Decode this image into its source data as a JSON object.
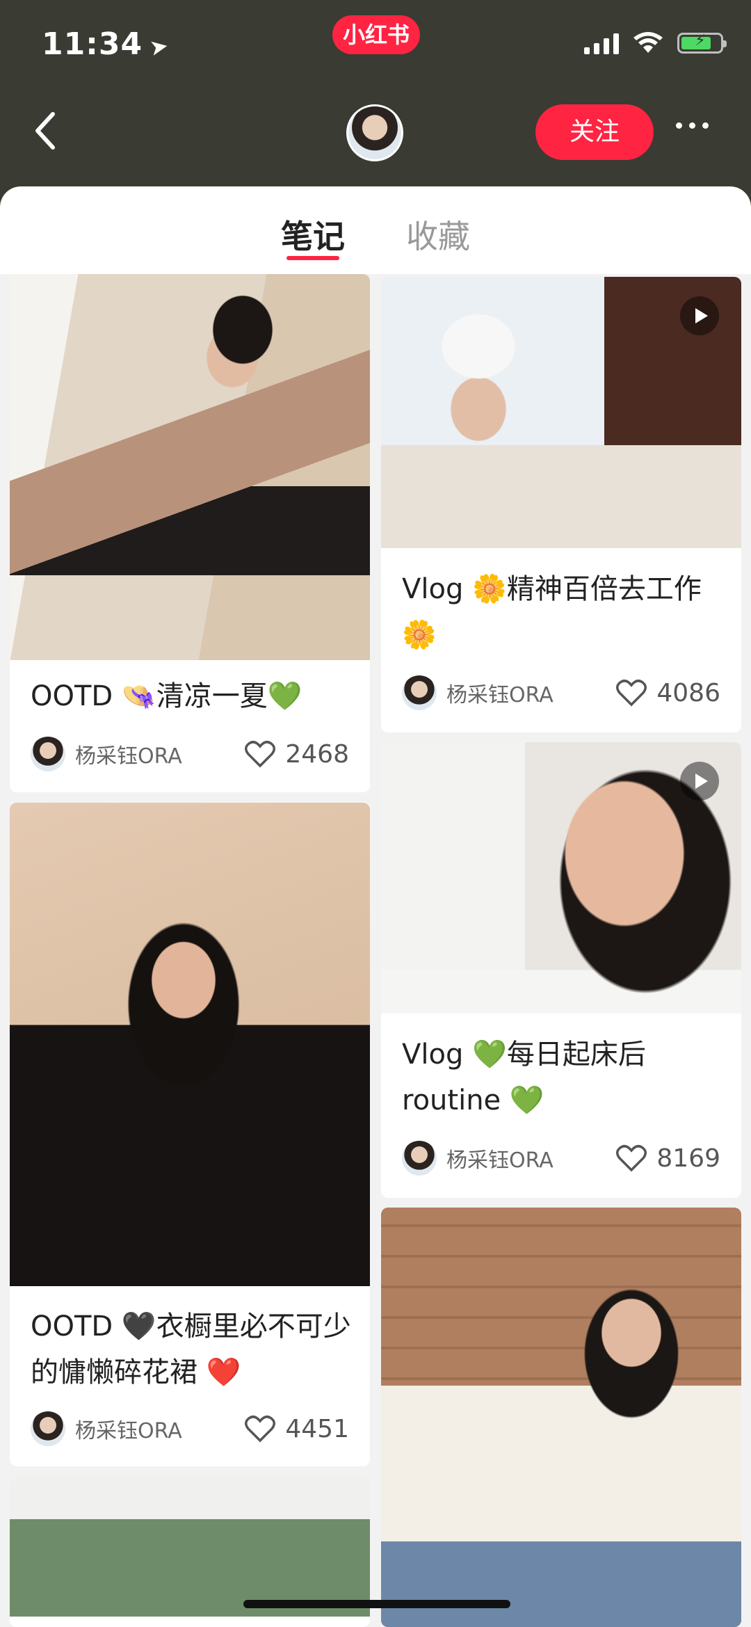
{
  "status_bar": {
    "time": "11:34",
    "app_badge": "小红书"
  },
  "header": {
    "follow_label": "关注"
  },
  "tabs": [
    {
      "label": "笔记"
    },
    {
      "label": "收藏"
    }
  ],
  "colors": {
    "header_bg": "#3a3b32",
    "accent": "#ff2442",
    "battery": "#4cd964"
  },
  "icons": [
    "location-arrow-icon",
    "cellular-signal-icon",
    "wifi-icon",
    "battery-icon",
    "back-chevron-icon",
    "more-dots-icon",
    "heart-icon",
    "play-icon"
  ],
  "feed": {
    "left": [
      {
        "title": "OOTD 👒清凉一夏💚",
        "author": "杨采钰ORA",
        "likes": "2468",
        "video": false
      },
      {
        "title": "OOTD 🖤衣橱里必不可少的慵懒碎花裙 ❤️",
        "author": "杨采钰ORA",
        "likes": "4451",
        "video": false
      }
    ],
    "right": [
      {
        "title": "Vlog 🌼精神百倍去工作🌼",
        "author": "杨采钰ORA",
        "likes": "4086",
        "video": true
      },
      {
        "title": "Vlog 💚每日起床后routine 💚",
        "author": "杨采钰ORA",
        "likes": "8169",
        "video": true
      }
    ]
  }
}
